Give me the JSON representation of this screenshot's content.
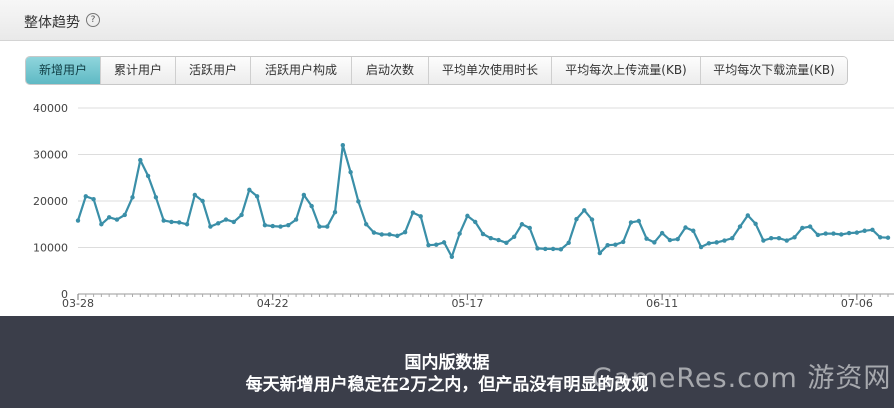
{
  "panel": {
    "title": "整体趋势",
    "help_icon": "help-circle-icon"
  },
  "tabs": [
    {
      "label": "新增用户",
      "active": true
    },
    {
      "label": "累计用户",
      "active": false
    },
    {
      "label": "活跃用户",
      "active": false
    },
    {
      "label": "活跃用户构成",
      "active": false
    },
    {
      "label": "启动次数",
      "active": false
    },
    {
      "label": "平均单次使用时长",
      "active": false
    },
    {
      "label": "平均每次上传流量(KB)",
      "active": false
    },
    {
      "label": "平均每次下载流量(KB)",
      "active": false
    }
  ],
  "caption": {
    "line1": "国内版数据",
    "line2": "每天新增用户稳定在2万之内，但产品没有明显的改观"
  },
  "watermark": "GameRes.com 游资网",
  "colors": {
    "line": "#3a8fa8",
    "tab_active": "#6cc2cc",
    "grid": "#dddddd",
    "background_bottom": "#3b3e4a"
  },
  "chart_data": {
    "type": "line",
    "title": "",
    "xlabel": "",
    "ylabel": "",
    "ylim": [
      0,
      40000
    ],
    "yticks": [
      0,
      10000,
      20000,
      30000,
      40000
    ],
    "xtick_labels": [
      {
        "label": "03-28",
        "index": 0
      },
      {
        "label": "04-22",
        "index": 25
      },
      {
        "label": "05-17",
        "index": 50
      },
      {
        "label": "06-11",
        "index": 75
      },
      {
        "label": "07-06",
        "index": 100
      }
    ],
    "grid": true,
    "series": [
      {
        "values": [
          15800,
          21000,
          20400,
          15000,
          16500,
          16000,
          17000,
          20800,
          28800,
          25400,
          20800,
          15800,
          15500,
          15400,
          15000,
          21300,
          20000,
          14500,
          15200,
          16000,
          15500,
          17000,
          22400,
          21000,
          14800,
          14600,
          14500,
          14800,
          16000,
          21300,
          18900,
          14500,
          14500,
          17600,
          32000,
          26200,
          19900,
          15000,
          13200,
          12800,
          12800,
          12500,
          13300,
          17500,
          16700,
          10500,
          10600,
          11100,
          8000,
          13000,
          16800,
          15500,
          12900,
          12000,
          11600,
          11000,
          12300,
          15000,
          14200,
          9800,
          9700,
          9700,
          9600,
          11000,
          16100,
          18000,
          16000,
          8800,
          10500,
          10600,
          11200,
          15400,
          15700,
          11900,
          11100,
          13100,
          11600,
          11800,
          14300,
          13600,
          10100,
          10900,
          11100,
          11500,
          12000,
          14500,
          16900,
          15100,
          11500,
          12000,
          12000,
          11500,
          12200,
          14200,
          14500,
          12700,
          13000,
          13000,
          12800,
          13100,
          13200,
          13600,
          13800,
          12200,
          12100
        ]
      }
    ]
  }
}
